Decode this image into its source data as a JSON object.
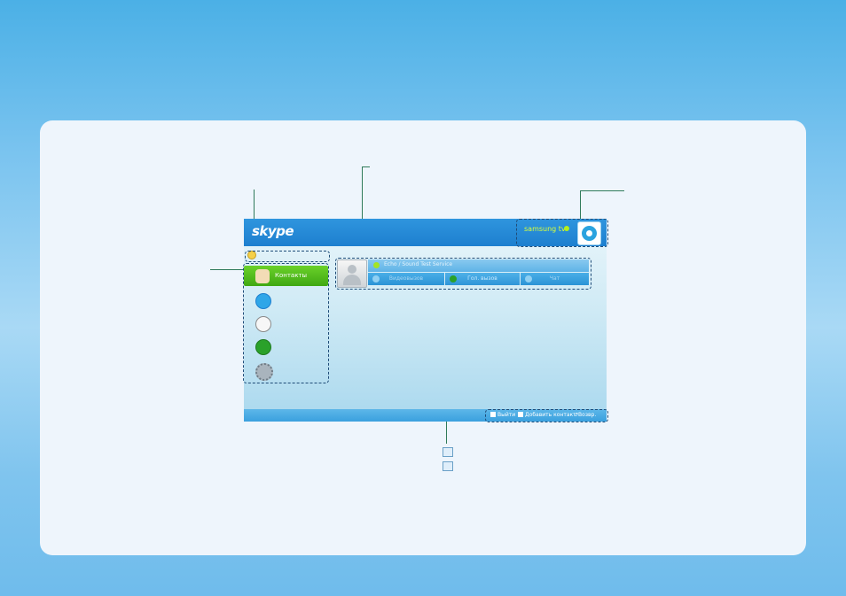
{
  "app": {
    "logo": "skype",
    "account_name": "samsung tv",
    "account_status_icon": "online-status-icon",
    "avatar_icon": "skype-avatar-icon"
  },
  "sidebar": {
    "mood_icon": "mood-icon",
    "items": [
      {
        "label": "Контакты",
        "icon": "contacts-icon",
        "active": true
      },
      {
        "label": "",
        "icon": "chat-icon",
        "active": false
      },
      {
        "label": "",
        "icon": "history-icon",
        "active": false
      },
      {
        "label": "",
        "icon": "phone-icon",
        "active": false
      },
      {
        "label": "",
        "icon": "settings-gear-icon",
        "active": false
      }
    ]
  },
  "contact": {
    "name": "Echo / Sound Test Service",
    "actions": {
      "video": "Видеовызов",
      "voice": "Гол. вызов",
      "chat": "Чат"
    }
  },
  "footer": {
    "logout": "Выйти",
    "add_contact": "Добавить контакт",
    "back": "Возвр."
  },
  "colors": {
    "header_blue": "#1d7fcf",
    "active_green": "#3fa812",
    "account_name": "#d9ff3a",
    "page_bg": "#4bb0e6"
  }
}
